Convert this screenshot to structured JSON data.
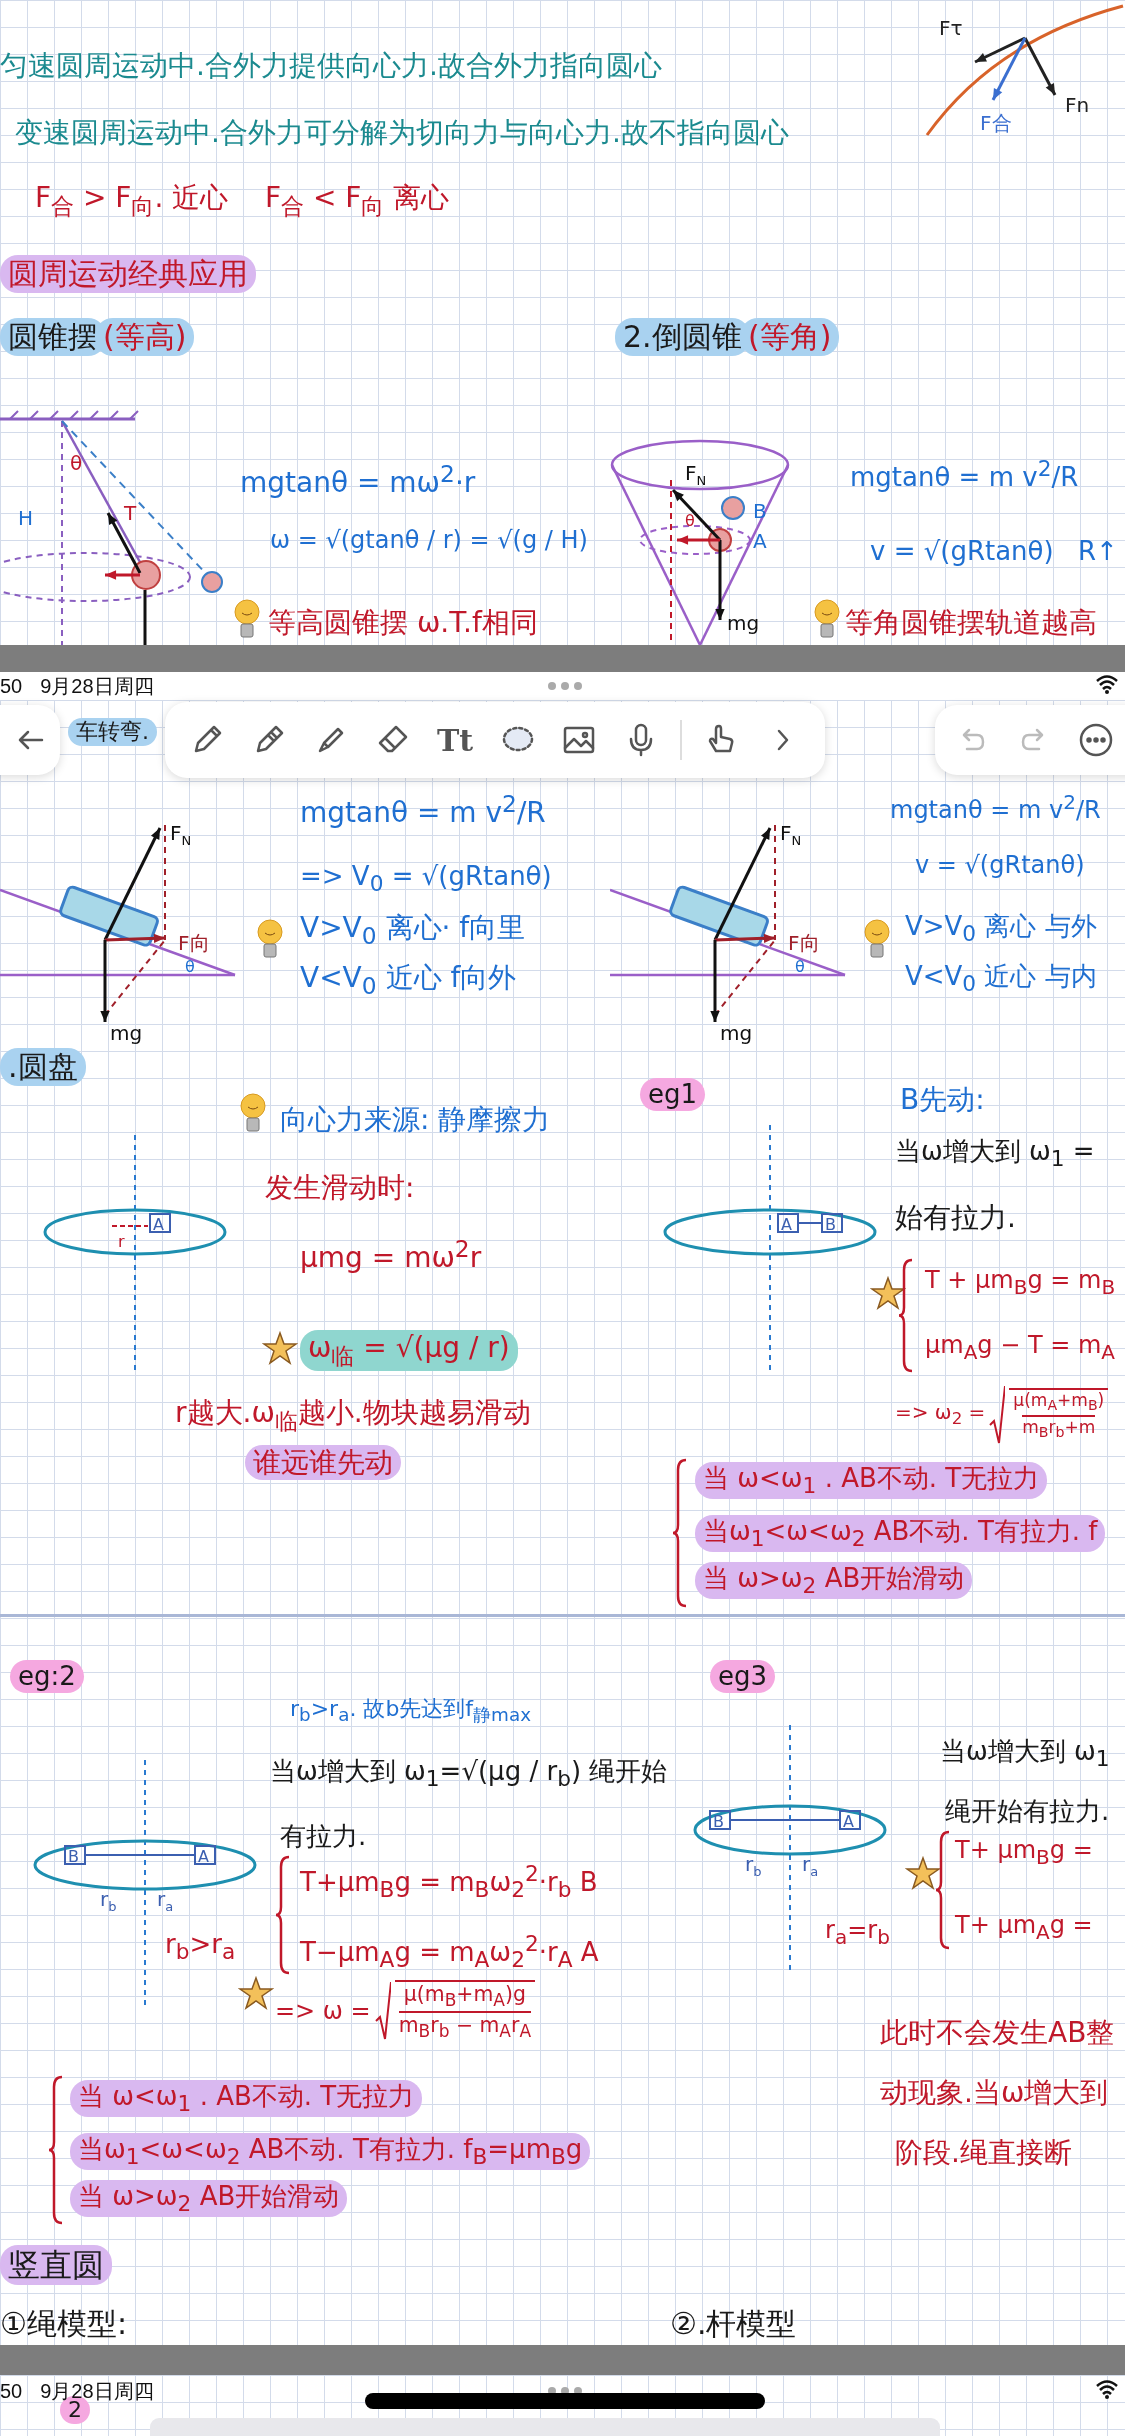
{
  "page_top": {
    "notes": [
      {
        "text": "匀速圆周运动中.合外力提供向心力.故合外力指向圆心",
        "color": "#1b8a8f"
      },
      {
        "text": "变速圆周运动中.合外力可分解为切向力与向心力.故不指向圆心",
        "color": "#1b8a8f"
      },
      {
        "text": "F$_{合}$ > F$_{向}$. 近心",
        "color": "#c0182a"
      },
      {
        "text": "F$_{合}$ < F$_{向}$ 离心",
        "color": "#c0182a"
      },
      {
        "text": "圆周运动经典应用",
        "color": "#c0182a",
        "highlight": {
          "color": "#d9b8f0"
        }
      },
      {
        "text": "圆锥摆",
        "color": "#1a1a1a",
        "highlight": {
          "color": "#a9d2f0"
        }
      },
      {
        "text": "(等高)",
        "color": "#c0182a",
        "highlight": {
          "color": "#a9d2f0"
        }
      },
      {
        "text": "2.倒圆锥",
        "color": "#1a1a1a",
        "highlight": {
          "color": "#a9d2f0"
        }
      },
      {
        "text": "(等角)",
        "color": "#c0182a",
        "highlight": {
          "color": "#a9d2f0"
        }
      },
      {
        "text": "mgtanθ = mω$^{2}$·r",
        "color": "#1f6fd1"
      },
      {
        "text": "ω = √(gtanθ / r) = √(g / H)",
        "color": "#1f6fd1"
      },
      {
        "text": "mgtanθ = m v$^{2}$/R",
        "color": "#1f6fd1"
      },
      {
        "text": "v = √(gRtanθ)",
        "color": "#1f6fd1"
      },
      {
        "text": "R↑",
        "color": "#1f6fd1"
      },
      {
        "text": "等高圆锥摆 ω.T.f相同",
        "color": "#c0182a"
      },
      {
        "text": "等角圆锥摆轨道越高",
        "color": "#c0182a"
      }
    ],
    "drawings": [
      {
        "kind": "force-arc",
        "labels": [
          {
            "text": "Fτ"
          },
          {
            "text": "Fn"
          },
          {
            "text": "F合"
          }
        ]
      },
      {
        "kind": "pendulum",
        "labels": [
          {
            "text": "θ"
          },
          {
            "text": "H"
          },
          {
            "text": "T"
          }
        ]
      },
      {
        "kind": "cone",
        "labels": [
          {
            "text": "F",
            "sub": "N"
          },
          {
            "text": "B"
          },
          {
            "text": "θ"
          },
          {
            "text": "A"
          },
          {
            "text": "mg"
          }
        ]
      }
    ]
  },
  "status_bar_1": {
    "time": "50",
    "date": "9月28日周四"
  },
  "toolbar": {
    "text_tool": "Tt"
  },
  "page_main": {
    "notes": [
      {
        "text": "车转弯.",
        "color": "#1a1a1a",
        "highlight": {
          "color": "#a9d2f0"
        }
      },
      {
        "text": "mgtanθ = m v$^{2}$/R",
        "color": "#1f6fd1"
      },
      {
        "text": "=> V$_{0}$ = √(gRtanθ)",
        "color": "#1f6fd1"
      },
      {
        "text": "V>V$_{0}$ 离心· f向里",
        "color": "#1f6fd1"
      },
      {
        "text": "V<V$_{0}$ 近心 f向外",
        "color": "#1f6fd1"
      },
      {
        "text": "mgtanθ = m v$^{2}$/R",
        "color": "#1f6fd1"
      },
      {
        "text": "v = √(gRtanθ)",
        "color": "#1f6fd1"
      },
      {
        "text": "V>V$_{0}$ 离心 与外",
        "color": "#1f6fd1"
      },
      {
        "text": "V<V$_{0}$ 近心 与内",
        "color": "#1f6fd1"
      },
      {
        "text": ".圆盘",
        "color": "#1a1a1a",
        "highlight": {
          "color": "#a9d2f0"
        }
      },
      {
        "text": "向心力来源: 静摩擦力",
        "color": "#1f6fd1"
      },
      {
        "text": "发生滑动时:",
        "color": "#c0182a"
      },
      {
        "text": "μmg = mω$^{2}$r",
        "color": "#c0182a"
      },
      {
        "text": "ω$_{临}$ = √(μg / r)",
        "color": "#c0182a",
        "highlight": {
          "color": "#8fd6cf"
        }
      },
      {
        "text": "r越大.ω$_{临}$越小.物块越易滑动",
        "color": "#c0182a"
      },
      {
        "text": "谁远谁先动",
        "color": "#c0182a",
        "highlight": {
          "color": "#d9b8f0"
        }
      },
      {
        "text": "eg1",
        "color": "#1a1a1a",
        "highlight": {
          "color": "#f5a8e0"
        }
      },
      {
        "text": "B先动:",
        "color": "#1f6fd1"
      },
      {
        "text": "当ω增大到 ω$_{1}$ =",
        "color": "#1a1a1a"
      },
      {
        "text": "始有拉力.",
        "color": "#1a1a1a"
      },
      {
        "text": "T + μm$_{B}$g = m$_{B}$",
        "color": "#c0182a"
      },
      {
        "text": "μm$_{A}$g − T = m$_{A}$",
        "color": "#c0182a"
      },
      {
        "text": "=> ω$_{2}$ =",
        "color": "#c0182a",
        "frac": {
          "num": "μ(m$_{A}$+m$_{B}$)",
          "den": "m$_{B}$r$_{b}$+m"
        }
      },
      {
        "text": "当 ω<ω$_{1}$ . AB不动. T无拉力",
        "color": "#c0182a",
        "highlight": {
          "color": "#d9b8f0"
        }
      },
      {
        "text": "当ω$_{1}$<ω<ω$_{2}$ AB不动. T有拉力. f",
        "color": "#c0182a",
        "highlight": {
          "color": "#d9b8f0"
        }
      },
      {
        "text": "当 ω>ω$_{2}$ AB开始滑动",
        "color": "#c0182a",
        "highlight": {
          "color": "#d9b8f0"
        }
      },
      {
        "text": "eg:2",
        "color": "#1a1a1a",
        "highlight": {
          "color": "#f5a8e0"
        }
      },
      {
        "text": "r$_{b}$>r$_{a}$. 故b先达到f$_{静max}$",
        "color": "#1f6fd1"
      },
      {
        "text": "当ω增大到 ω$_{1}$=√(μg / r$_{b}$) 绳开始",
        "color": "#1a1a1a"
      },
      {
        "text": "有拉力.",
        "color": "#1a1a1a"
      },
      {
        "text": "r$_{b}$>r$_{a}$",
        "color": "#c0182a"
      },
      {
        "text": "T+μm$_{B}$g = m$_{B}$ω$_{2}$$^{2}$·r$_{b}$   B",
        "color": "#c0182a"
      },
      {
        "text": "T−μm$_{A}$g = m$_{A}$ω$_{2}$$^{2}$·r$_{A}$   A",
        "color": "#c0182a"
      },
      {
        "text": "=> ω =",
        "color": "#c0182a",
        "frac": {
          "num": "μ(m$_{B}$+m$_{A}$)g",
          "den": "m$_{B}$r$_{b}$ − m$_{A}$r$_{A}$"
        }
      },
      {
        "text": "当 ω<ω$_{1}$ . AB不动. T无拉力",
        "color": "#c0182a",
        "highlight": {
          "color": "#d9b8f0"
        }
      },
      {
        "text": "当ω$_{1}$<ω<ω$_{2}$ AB不动. T有拉力. f$_{B}$=μm$_{B}$g",
        "color": "#c0182a",
        "highlight": {
          "color": "#d9b8f0"
        }
      },
      {
        "text": "当 ω>ω$_{2}$ AB开始滑动",
        "color": "#c0182a",
        "highlight": {
          "color": "#d9b8f0"
        }
      },
      {
        "text": "eg3",
        "color": "#1a1a1a",
        "highlight": {
          "color": "#f5a8e0"
        }
      },
      {
        "text": "当ω增大到 ω$_{1}$",
        "color": "#1a1a1a"
      },
      {
        "text": "绳开始有拉力.",
        "color": "#1a1a1a"
      },
      {
        "text": "T+ μm$_{B}$g =",
        "color": "#c0182a"
      },
      {
        "text": "r$_{a}$=r$_{b}$",
        "color": "#c0182a"
      },
      {
        "text": "T+ μm$_{A}$g =",
        "color": "#c0182a"
      },
      {
        "text": "此时不会发生AB整",
        "color": "#c0182a"
      },
      {
        "text": "动现象.当ω增大到",
        "color": "#c0182a"
      },
      {
        "text": "阶段.绳直接断",
        "color": "#c0182a"
      },
      {
        "text": "竖直圆",
        "color": "#1a1a1a",
        "highlight": {
          "color": "#d9b8f0"
        }
      },
      {
        "text": "①绳模型:",
        "color": "#1a1a1a"
      },
      {
        "text": "②.杆模型",
        "color": "#1a1a1a"
      }
    ],
    "drawings": [
      {
        "kind": "incline",
        "labels": [
          {
            "text": "F",
            "sub": "N"
          },
          {
            "text": "F向"
          },
          {
            "text": "θ"
          },
          {
            "text": "mg"
          }
        ]
      },
      {
        "kind": "incline",
        "labels": [
          {
            "text": "F",
            "sub": "N"
          },
          {
            "text": "F向"
          },
          {
            "text": "θ"
          },
          {
            "text": "mg"
          }
        ]
      },
      {
        "kind": "disk",
        "labels": [
          {
            "text": "A"
          },
          {
            "text": "r"
          }
        ]
      },
      {
        "kind": "disk-pair",
        "labels": [
          {
            "text": "A"
          },
          {
            "text": "B"
          }
        ]
      },
      {
        "kind": "disk-radii",
        "labels": [
          {
            "text": "B"
          },
          {
            "text": "r",
            "sub": "b"
          },
          {
            "text": "r",
            "sub": "a"
          },
          {
            "text": "A"
          }
        ]
      },
      {
        "kind": "disk-radii",
        "labels": [
          {
            "text": "B"
          },
          {
            "text": "r",
            "sub": "b"
          },
          {
            "text": "r",
            "sub": "a"
          },
          {
            "text": "A"
          }
        ]
      }
    ]
  },
  "status_bar_2": {
    "time": "50",
    "date": "9月28日周四"
  },
  "page_bottom": {
    "notes": [
      {
        "text": "2",
        "color": "#1a1a1a",
        "highlight": {
          "color": "#f5a8e0"
        }
      }
    ]
  }
}
